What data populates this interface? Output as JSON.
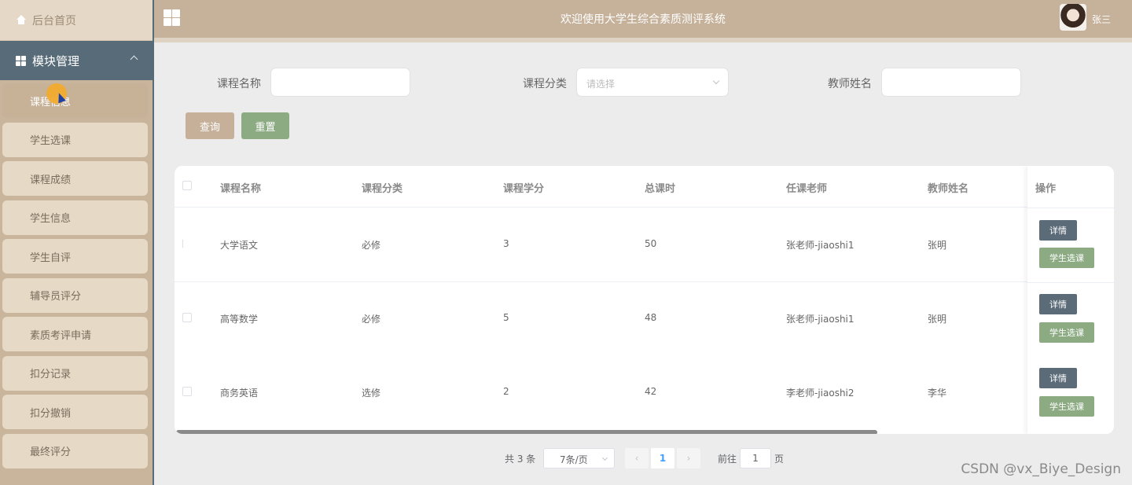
{
  "sidebar": {
    "home_label": "后台首页",
    "group_label": "模块管理",
    "items": [
      {
        "label": "课程信息"
      },
      {
        "label": "学生选课"
      },
      {
        "label": "课程成绩"
      },
      {
        "label": "学生信息"
      },
      {
        "label": "学生自评"
      },
      {
        "label": "辅导员评分"
      },
      {
        "label": "素质考评申请"
      },
      {
        "label": "扣分记录"
      },
      {
        "label": "扣分撤销"
      },
      {
        "label": "最终评分"
      }
    ]
  },
  "header": {
    "title": "欢迎使用大学生综合素质测评系统",
    "username": "张三"
  },
  "search": {
    "course_name_label": "课程名称",
    "course_name_value": "",
    "course_category_label": "课程分类",
    "course_category_placeholder": "请选择",
    "teacher_name_label": "教师姓名",
    "teacher_name_value": "",
    "query_label": "查询",
    "reset_label": "重置"
  },
  "table": {
    "columns": [
      "课程名称",
      "课程分类",
      "课程学分",
      "总课时",
      "任课老师",
      "教师姓名"
    ],
    "action_header": "操作",
    "detail_label": "详情",
    "select_label": "学生选课",
    "rows": [
      [
        "大学语文",
        "必修",
        "3",
        "50",
        "张老师-jiaoshi1",
        "张明"
      ],
      [
        "高等数学",
        "必修",
        "5",
        "48",
        "张老师-jiaoshi1",
        "张明"
      ],
      [
        "商务英语",
        "选修",
        "2",
        "42",
        "李老师-jiaoshi2",
        "李华"
      ]
    ]
  },
  "pagination": {
    "total": "共 3 条",
    "page_size": "7条/页",
    "prev": "‹",
    "current": "1",
    "next": "›",
    "goto_label": "前往",
    "goto_value": "1",
    "page_suffix": "页"
  },
  "watermark": "CSDN @vx_Biye_Design",
  "colors": {
    "sidebar_bg": "#c9b59c",
    "sidebar_group": "#586b78",
    "header_bg": "#c6b19a",
    "query_button": "#c6b09a",
    "reset_button": "#8cab83",
    "detail_button": "#5b6b78",
    "select_button": "#8cab83"
  }
}
